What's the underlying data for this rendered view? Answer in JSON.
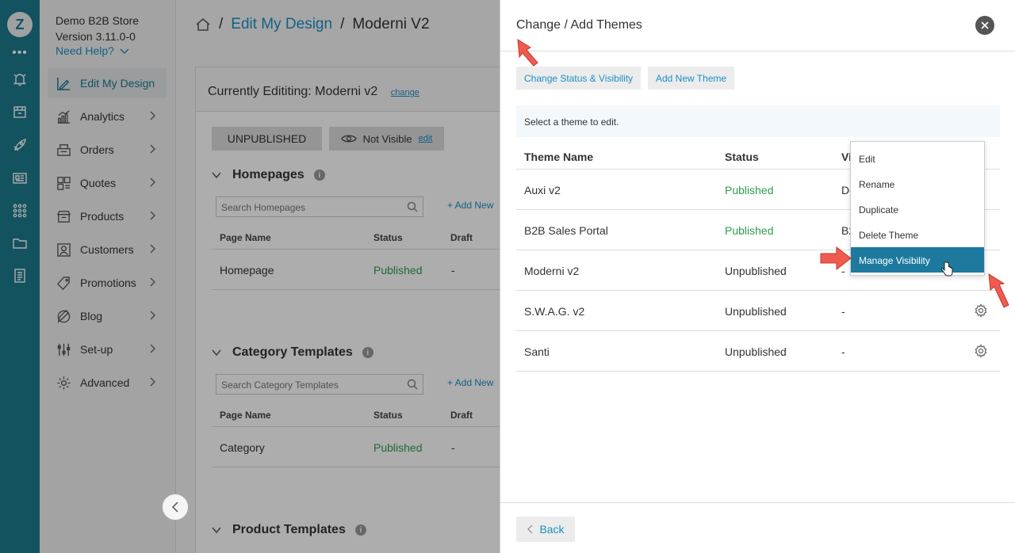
{
  "rail": {
    "logo_letter": "Z",
    "dots": "•••",
    "icons": [
      "bell-icon",
      "store-icon",
      "rocket-icon",
      "newspaper-icon",
      "apps-grid-icon",
      "folder-icon",
      "document-icon"
    ]
  },
  "sidebar": {
    "store_name": "Demo B2B Store",
    "version": "Version 3.11.0-0",
    "help_label": "Need Help?",
    "items": [
      {
        "label": "Edit My Design",
        "icon": "design-icon",
        "active": true
      },
      {
        "label": "Analytics",
        "icon": "analytics-icon"
      },
      {
        "label": "Orders",
        "icon": "orders-icon"
      },
      {
        "label": "Quotes",
        "icon": "quotes-icon"
      },
      {
        "label": "Products",
        "icon": "products-icon"
      },
      {
        "label": "Customers",
        "icon": "customers-icon"
      },
      {
        "label": "Promotions",
        "icon": "promotions-icon"
      },
      {
        "label": "Blog",
        "icon": "blog-icon"
      },
      {
        "label": "Set-up",
        "icon": "setup-icon"
      },
      {
        "label": "Advanced",
        "icon": "advanced-icon"
      }
    ]
  },
  "breadcrumb": {
    "sep": "/",
    "parent": "Edit My Design",
    "current": "Moderni V2"
  },
  "editor": {
    "heading": "Currently Edititing: Moderni v2",
    "change_label": "change",
    "status_pill": "UNPUBLISHED",
    "visibility": "Not Visible",
    "edit_label": "edit",
    "help_glyph": "i",
    "sections": [
      {
        "title": "Homepages",
        "search_placeholder": "Search Homepages",
        "add_label": "+ Add New",
        "columns": [
          "Page Name",
          "Status",
          "Draft"
        ],
        "row": {
          "name": "Homepage",
          "status": "Published",
          "draft": "-"
        }
      },
      {
        "title": "Category Templates",
        "search_placeholder": "Search Category Templates",
        "add_label": "+ Add New",
        "columns": [
          "Page Name",
          "Status",
          "Draft"
        ],
        "row": {
          "name": "Category",
          "status": "Published",
          "draft": "-"
        }
      },
      {
        "title": "Product Templates"
      }
    ]
  },
  "panel": {
    "title": "Change / Add Themes",
    "btn_status": "Change Status & Visibility",
    "btn_add": "Add New Theme",
    "notice": "Select a theme to edit.",
    "columns": [
      "Theme Name",
      "Status",
      "Vi"
    ],
    "themes": [
      {
        "name": "Auxi v2",
        "status": "Published",
        "visibility": "De"
      },
      {
        "name": "B2B Sales Portal",
        "status": "Published",
        "visibility": "B2"
      },
      {
        "name": "Moderni v2",
        "status": "Unpublished",
        "visibility": "-"
      },
      {
        "name": "S.W.A.G. v2",
        "status": "Unpublished",
        "visibility": "-"
      },
      {
        "name": "Santi",
        "status": "Unpublished",
        "visibility": "-"
      }
    ],
    "menu": [
      "Edit",
      "Rename",
      "Duplicate",
      "Delete Theme",
      "Manage Visibility"
    ],
    "back_label": "Back",
    "colors": {
      "published": "#2e9d4b",
      "accent": "#1d8fc4",
      "menu_selected": "#1d7a9e",
      "arrow": "#f05a4f"
    }
  }
}
